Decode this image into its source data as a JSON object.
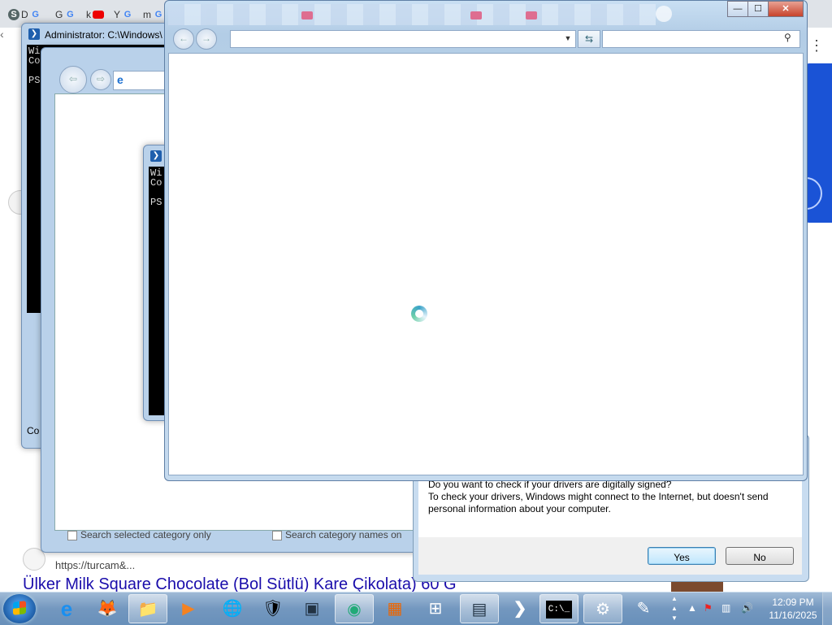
{
  "background_browser": {
    "tabs": [
      {
        "label": "D"
      },
      {
        "label": "G"
      },
      {
        "label": "k"
      },
      {
        "label": "Y"
      },
      {
        "label": "m"
      }
    ],
    "result_url": "https://turcam&...",
    "result_title": "Ülker Milk Square Chocolate (Bol Sütlü) Kare Çikolata) 60 G"
  },
  "ps_window_1": {
    "title": "Administrator: C:\\Windows\\",
    "console_lines": [
      "Wi",
      "Co",
      "",
      "PS"
    ],
    "status_text": "Co"
  },
  "ie_window_1": {
    "footer_left": "Search selected category only",
    "footer_right": "Search category names on"
  },
  "ps_window_2": {
    "console_lines": [
      "Wi",
      "Co",
      "",
      "PS"
    ]
  },
  "main_ie": {
    "address_value": "",
    "search_value": "",
    "caption": {
      "minimize": "—",
      "maximize": "☐",
      "close": "✕"
    }
  },
  "dialog": {
    "line1": "Do you want to check if your drivers are digitally signed?",
    "line2": "To check your drivers, Windows might connect to the Internet, but doesn't send personal information about your computer.",
    "yes_label": "Yes",
    "no_label": "No"
  },
  "taskbar": {
    "clock_time": "12:09 PM",
    "clock_date": "11/16/2025",
    "icons": [
      {
        "name": "ie",
        "glyph": "e"
      },
      {
        "name": "firefox",
        "glyph": "🦊"
      },
      {
        "name": "explorer",
        "glyph": "📁"
      },
      {
        "name": "media-player",
        "glyph": "▶"
      },
      {
        "name": "network",
        "glyph": "🌐"
      },
      {
        "name": "security",
        "glyph": "🛡"
      },
      {
        "name": "virtualbox",
        "glyph": "▣"
      },
      {
        "name": "chrome",
        "glyph": "◉"
      },
      {
        "name": "office",
        "glyph": "▦"
      },
      {
        "name": "windows-flag",
        "glyph": "⊞"
      },
      {
        "name": "calculator",
        "glyph": "▤"
      },
      {
        "name": "powershell",
        "glyph": "❯"
      },
      {
        "name": "cmd",
        "glyph": "C:\\_"
      },
      {
        "name": "control-panel",
        "glyph": "⚙"
      },
      {
        "name": "notepad",
        "glyph": "✎"
      }
    ]
  }
}
